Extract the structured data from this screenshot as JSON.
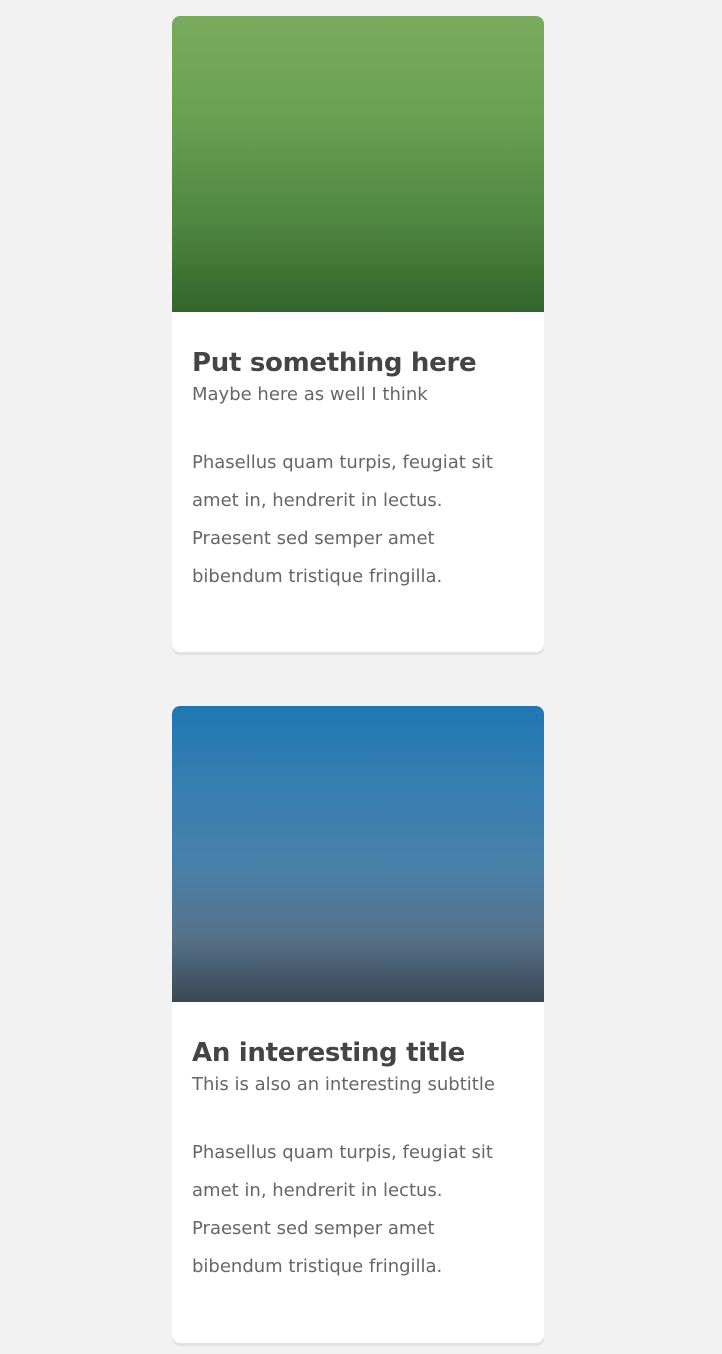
{
  "cards": [
    {
      "title": "Put something here",
      "subtitle": "Maybe here as well I think",
      "text": "Phasellus quam turpis, feugiat sit amet in, hendrerit in lectus. Praesent sed semper amet bibendum tristique fringilla.",
      "image_gradient": [
        "#7aab5e",
        "#33652c"
      ]
    },
    {
      "title": "An interesting title",
      "subtitle": "This is also an interesting subtitle",
      "text": "Phasellus quam turpis, feugiat sit amet in, hendrerit in lectus. Praesent sed semper amet bibendum tristique fringilla.",
      "image_gradient": [
        "#1f77b3",
        "#394854"
      ]
    }
  ],
  "colors": {
    "background": "#f2f2f2",
    "card": "#ffffff",
    "title": "#444444",
    "body_text": "#666666"
  }
}
